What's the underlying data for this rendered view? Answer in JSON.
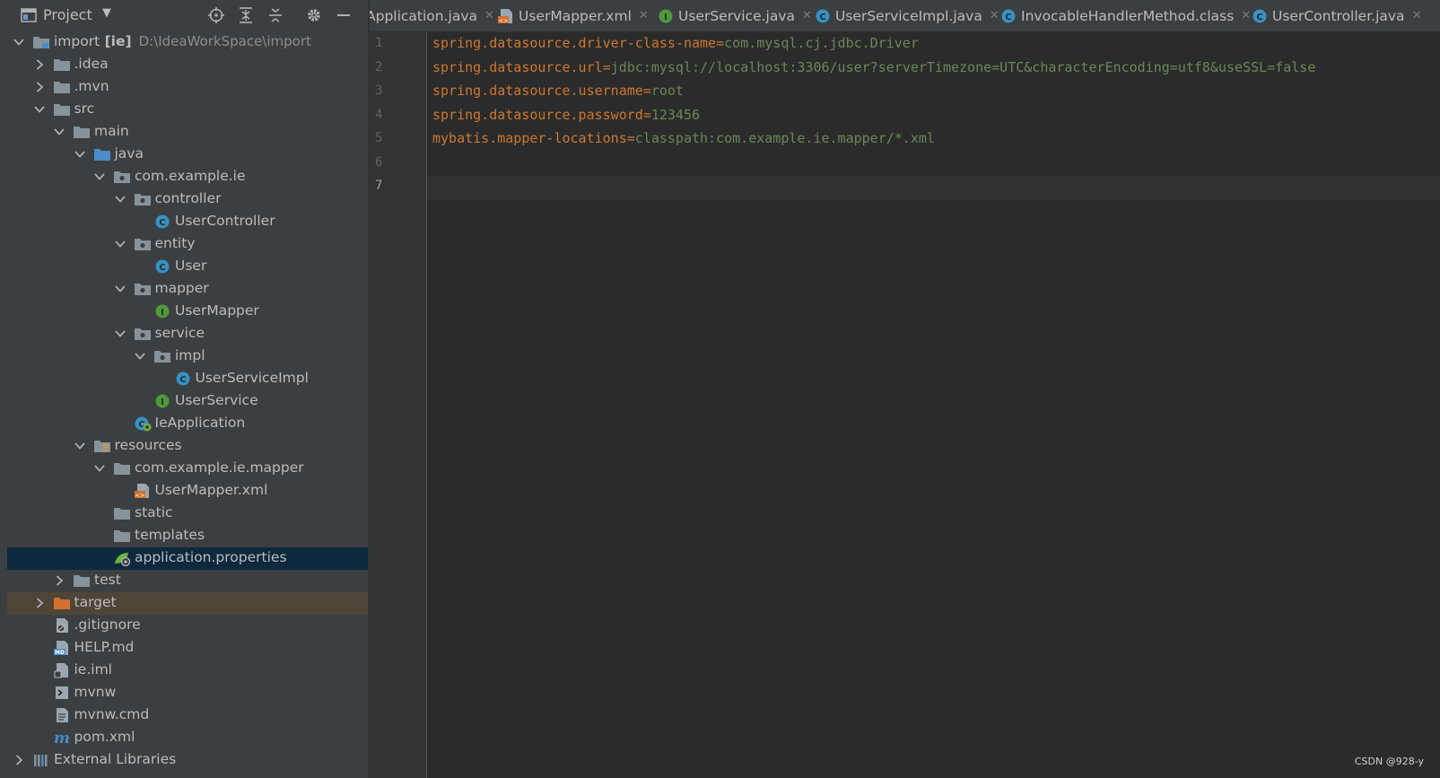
{
  "project_panel": {
    "title": "Project",
    "caret": "▼",
    "tree": [
      {
        "id": "import",
        "label": "import",
        "bold": "[ie]",
        "path": "D:\\IdeaWorkSpace\\import",
        "depth": 0,
        "arrow": "down",
        "icon": "module-folder-icon"
      },
      {
        "id": "idea",
        "label": ".idea",
        "depth": 1,
        "arrow": "right",
        "icon": "folder-icon"
      },
      {
        "id": "mvn",
        "label": ".mvn",
        "depth": 1,
        "arrow": "right",
        "icon": "folder-icon"
      },
      {
        "id": "src",
        "label": "src",
        "depth": 1,
        "arrow": "down",
        "icon": "folder-icon"
      },
      {
        "id": "main",
        "label": "main",
        "depth": 2,
        "arrow": "down",
        "icon": "folder-icon"
      },
      {
        "id": "java",
        "label": "java",
        "depth": 3,
        "arrow": "down",
        "icon": "source-folder-icon"
      },
      {
        "id": "com-example-ie",
        "label": "com.example.ie",
        "depth": 4,
        "arrow": "down",
        "icon": "package-icon"
      },
      {
        "id": "controller",
        "label": "controller",
        "depth": 5,
        "arrow": "down",
        "icon": "package-icon"
      },
      {
        "id": "usercontroller",
        "label": "UserController",
        "depth": 6,
        "arrow": "none",
        "icon": "class-icon"
      },
      {
        "id": "entity",
        "label": "entity",
        "depth": 5,
        "arrow": "down",
        "icon": "package-icon"
      },
      {
        "id": "user",
        "label": "User",
        "depth": 6,
        "arrow": "none",
        "icon": "class-icon"
      },
      {
        "id": "mapper",
        "label": "mapper",
        "depth": 5,
        "arrow": "down",
        "icon": "package-icon"
      },
      {
        "id": "usermapper",
        "label": "UserMapper",
        "depth": 6,
        "arrow": "none",
        "icon": "interface-icon"
      },
      {
        "id": "service",
        "label": "service",
        "depth": 5,
        "arrow": "down",
        "icon": "package-icon"
      },
      {
        "id": "impl",
        "label": "impl",
        "depth": 6,
        "arrow": "down",
        "icon": "package-icon"
      },
      {
        "id": "userserviceimpl",
        "label": "UserServiceImpl",
        "depth": 7,
        "arrow": "none",
        "icon": "class-icon"
      },
      {
        "id": "userservice",
        "label": "UserService",
        "depth": 6,
        "arrow": "none",
        "icon": "interface-icon"
      },
      {
        "id": "ieapplication",
        "label": "IeApplication",
        "depth": 5,
        "arrow": "none",
        "icon": "spring-class-icon"
      },
      {
        "id": "resources",
        "label": "resources",
        "depth": 3,
        "arrow": "down",
        "icon": "resources-folder-icon"
      },
      {
        "id": "com-example-ie-mapper",
        "label": "com.example.ie.mapper",
        "depth": 4,
        "arrow": "down",
        "icon": "folder-icon"
      },
      {
        "id": "usermapper-xml",
        "label": "UserMapper.xml",
        "depth": 5,
        "arrow": "none",
        "icon": "xml-file-icon"
      },
      {
        "id": "static",
        "label": "static",
        "depth": 4,
        "arrow": "none",
        "icon": "folder-icon"
      },
      {
        "id": "templates",
        "label": "templates",
        "depth": 4,
        "arrow": "none",
        "icon": "folder-icon"
      },
      {
        "id": "application-properties",
        "label": "application.properties",
        "depth": 4,
        "arrow": "none",
        "icon": "spring-properties-icon",
        "selected": true
      },
      {
        "id": "test",
        "label": "test",
        "depth": 2,
        "arrow": "right",
        "icon": "folder-icon"
      },
      {
        "id": "target",
        "label": "target",
        "depth": 1,
        "arrow": "right",
        "icon": "excluded-folder-icon",
        "highlight": true
      },
      {
        "id": "gitignore",
        "label": ".gitignore",
        "depth": 1,
        "arrow": "none",
        "icon": "ignore-file-icon"
      },
      {
        "id": "help-md",
        "label": "HELP.md",
        "depth": 1,
        "arrow": "none",
        "icon": "markdown-file-icon"
      },
      {
        "id": "ie-iml",
        "label": "ie.iml",
        "depth": 1,
        "arrow": "none",
        "icon": "iml-file-icon"
      },
      {
        "id": "mvnw",
        "label": "mvnw",
        "depth": 1,
        "arrow": "none",
        "icon": "shell-file-icon"
      },
      {
        "id": "mvnw-cmd",
        "label": "mvnw.cmd",
        "depth": 1,
        "arrow": "none",
        "icon": "text-file-icon"
      },
      {
        "id": "pom-xml",
        "label": "pom.xml",
        "depth": 1,
        "arrow": "none",
        "icon": "maven-file-icon"
      },
      {
        "id": "external-libraries",
        "label": "External Libraries",
        "depth": 0,
        "arrow": "right",
        "icon": "libraries-icon"
      }
    ]
  },
  "tabs": [
    {
      "label": "Application.java",
      "icon": "none",
      "partial": true
    },
    {
      "label": "UserMapper.xml",
      "icon": "xml-file-icon"
    },
    {
      "label": "UserService.java",
      "icon": "interface-icon"
    },
    {
      "label": "UserServiceImpl.java",
      "icon": "class-icon"
    },
    {
      "label": "InvocableHandlerMethod.class",
      "icon": "class-icon",
      "active": true
    },
    {
      "label": "UserController.java",
      "icon": "class-icon"
    }
  ],
  "tab_close_glyph": "✕",
  "editor": {
    "current_line": 7,
    "lines": [
      {
        "n": "1",
        "key": "spring.datasource.driver-class-name",
        "eq": "=",
        "value": "com.mysql.cj.jdbc.Driver"
      },
      {
        "n": "2",
        "key": "spring.datasource.url",
        "eq": "=",
        "value": "jdbc:mysql://localhost:3306/user?serverTimezone=UTC&characterEncoding=utf8&useSSL=false"
      },
      {
        "n": "3",
        "key": "spring.datasource.username",
        "eq": "=",
        "value": "root"
      },
      {
        "n": "4",
        "key": "spring.datasource.password",
        "eq": "=",
        "value": "123456"
      },
      {
        "n": "5",
        "key": "mybatis.mapper-locations",
        "eq": "=",
        "value": "classpath:com.example.ie.mapper/*.xml"
      },
      {
        "n": "6",
        "key": "",
        "eq": "",
        "value": ""
      },
      {
        "n": "7",
        "key": "",
        "eq": "",
        "value": ""
      }
    ]
  },
  "watermark": "CSDN @928-y",
  "colors": {
    "panel_bg": "#3c3f41",
    "editor_bg": "#2b2b2b",
    "selection": "#0d293e",
    "key": "#cc7832",
    "value": "#6a8759",
    "class_icon": "#3592c4",
    "interface_icon": "#4e9a3a"
  }
}
